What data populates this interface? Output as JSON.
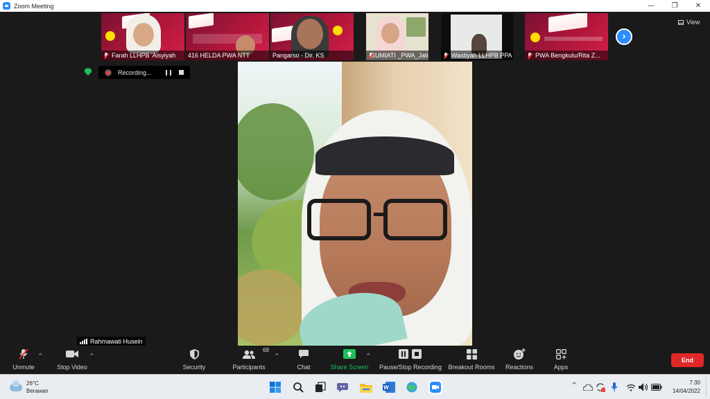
{
  "window": {
    "title": "Zoom Meeting",
    "minimize_glyph": "—",
    "restore_glyph": "❐",
    "close_glyph": "✕"
  },
  "view_button": {
    "label": "View"
  },
  "next_page_glyph": "›",
  "thumbnails": [
    {
      "name": "Farah LLHPB 'Aisyiyah",
      "muted": true
    },
    {
      "name": "416 HELDA PWA NTT",
      "muted": false
    },
    {
      "name": "Pangarso - Dir. KS",
      "muted": false
    },
    {
      "name": "SUMIATI _PWA_Jatim",
      "muted": true
    },
    {
      "name": "Wastiyah LLHPB PPA",
      "muted": true
    },
    {
      "name": "PWA Bengkulu/Rita Z...",
      "muted": true
    }
  ],
  "recording": {
    "label": "Recording..."
  },
  "active_speaker": {
    "name": "Rahmawati Husein"
  },
  "toolbar": {
    "unmute": "Unmute",
    "stop_video": "Stop Video",
    "security": "Security",
    "participants": "Participants",
    "participants_count": "68",
    "chat": "Chat",
    "share_screen": "Share Screen",
    "pause_stop_recording": "Pause/Stop Recording",
    "breakout_rooms": "Breakout Rooms",
    "reactions": "Reactions",
    "apps": "Apps",
    "end": "End",
    "caret_glyph": "^"
  },
  "taskbar": {
    "weather_temp": "26°C",
    "weather_desc": "Berawan",
    "tray_up_glyph": "^",
    "time": "7:30",
    "date": "14/04/2022"
  },
  "colors": {
    "zoom_blue": "#2d8cff",
    "end_red": "#e02828",
    "share_green": "#1fbf5a",
    "banner_magenta": "#b0163a"
  }
}
